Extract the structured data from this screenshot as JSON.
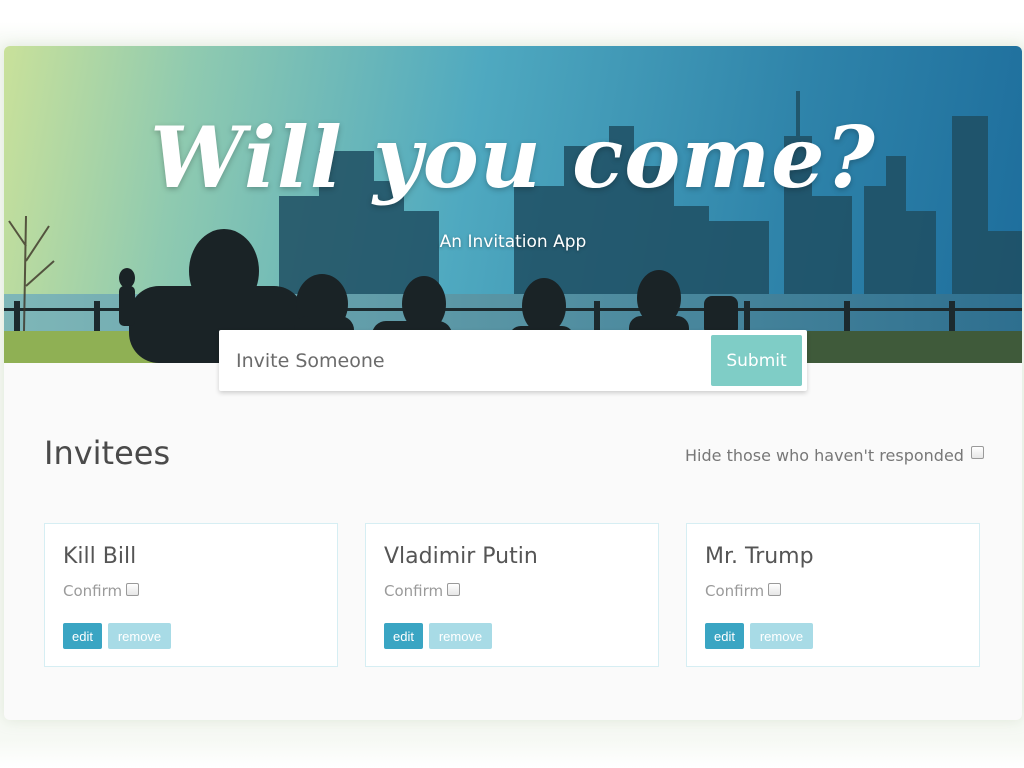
{
  "hero": {
    "title": "Will you come?",
    "subtitle": "An Invitation App"
  },
  "invite_form": {
    "placeholder": "Invite Someone",
    "submit_label": "Submit"
  },
  "invitees": {
    "title": "Invitees",
    "filter_label": "Hide those who haven't responded",
    "cards": [
      {
        "name": "Kill Bill",
        "confirm_label": "Confirm",
        "edit_label": "edit",
        "remove_label": "remove"
      },
      {
        "name": "Vladimir Putin",
        "confirm_label": "Confirm",
        "edit_label": "edit",
        "remove_label": "remove"
      },
      {
        "name": "Mr. Trump",
        "confirm_label": "Confirm",
        "edit_label": "edit",
        "remove_label": "remove"
      }
    ]
  },
  "colors": {
    "accent_teal": "#7fcdc6",
    "edit_button": "#3aa5c3",
    "remove_button": "#a8dbe6"
  }
}
